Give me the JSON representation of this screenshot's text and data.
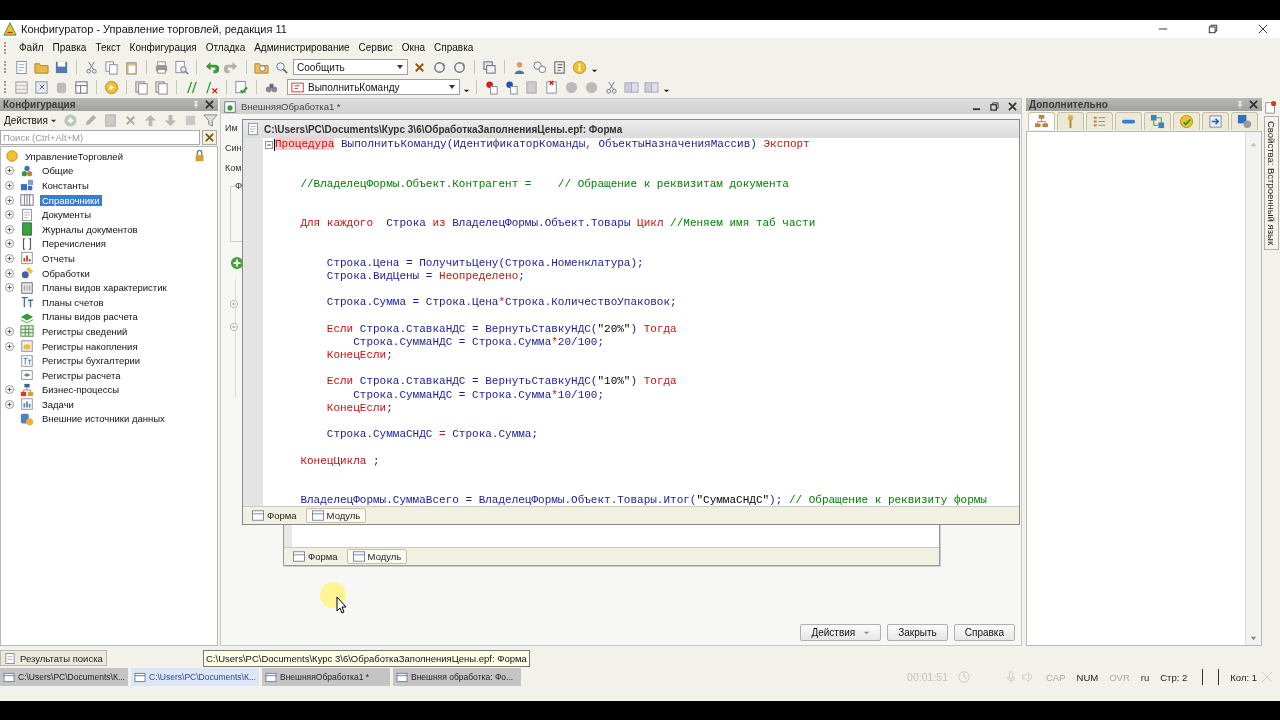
{
  "window": {
    "title": "Конфигуратор - Управление торговлей, редакция 11"
  },
  "menu": [
    "Файл",
    "Правка",
    "Текст",
    "Конфигурация",
    "Отладка",
    "Администрирование",
    "Сервис",
    "Окна",
    "Справка"
  ],
  "toolbar": {
    "search_combo": {
      "value": "Сообщить"
    },
    "procedure_combo": {
      "value": "ВыполнитьКоманду"
    }
  },
  "config_panel": {
    "title": "Конфигурация",
    "actions_label": "Действия",
    "search": {
      "placeholder": "Поиск (Ctrl+Alt+M)"
    },
    "tree": [
      {
        "label": "УправлениеТорговлей",
        "children": [
          {
            "label": "Общие",
            "expandable": true,
            "selected": false
          },
          {
            "label": "Константы",
            "expandable": true,
            "selected": false
          },
          {
            "label": "Справочники",
            "expandable": true,
            "selected": true
          },
          {
            "label": "Документы",
            "expandable": true,
            "selected": false
          },
          {
            "label": "Журналы документов",
            "expandable": true,
            "selected": false
          },
          {
            "label": "Перечисления",
            "expandable": true,
            "selected": false
          },
          {
            "label": "Отчеты",
            "expandable": true,
            "selected": false
          },
          {
            "label": "Обработки",
            "expandable": true,
            "selected": false
          },
          {
            "label": "Планы видов характеристик",
            "expandable": true,
            "selected": false
          },
          {
            "label": "Планы счетов",
            "expandable": false,
            "selected": false
          },
          {
            "label": "Планы видов расчета",
            "expandable": false,
            "selected": false
          },
          {
            "label": "Регистры сведений",
            "expandable": true,
            "selected": false
          },
          {
            "label": "Регистры накопления",
            "expandable": true,
            "selected": false
          },
          {
            "label": "Регистры бухгалтерии",
            "expandable": false,
            "selected": false
          },
          {
            "label": "Регистры расчета",
            "expandable": false,
            "selected": false
          },
          {
            "label": "Бизнес-процессы",
            "expandable": true,
            "selected": false
          },
          {
            "label": "Задачи",
            "expandable": true,
            "selected": false
          },
          {
            "label": "Внешние источники данных",
            "expandable": false,
            "selected": false
          }
        ]
      }
    ]
  },
  "back_window": {
    "title": "ВнешняяОбработка1 *",
    "field_labels": [
      "Им",
      "Син",
      "Ком"
    ],
    "group_label": "Ф",
    "buttons": [
      {
        "label": "Действия",
        "dropdown": true
      },
      {
        "label": "Закрыть",
        "dropdown": false
      },
      {
        "label": "Справка",
        "dropdown": false
      }
    ]
  },
  "inner_window": {
    "tabs": [
      {
        "label": "Форма",
        "selected": false
      },
      {
        "label": "Модуль",
        "selected": true
      }
    ]
  },
  "code_window": {
    "title": "C:\\Users\\PC\\Documents\\Курс 3\\6\\ОбработкаЗаполненияЦены.epf: Форма",
    "lines": [
      {
        "kind": "fold",
        "tokens": [
          {
            "kind": "keyword",
            "text": "Процедура",
            "highlight": true
          },
          {
            "kind": "code",
            "text": " ВыполнитьКоманду(ИдентификаторКоманды"
          },
          {
            "kind": "keyword",
            "text": ","
          },
          {
            "kind": "code",
            "text": " ОбъектыНазначенияМассив) "
          },
          {
            "kind": "keyword",
            "text": "Экспорт"
          }
        ]
      },
      {
        "kind": "blank"
      },
      {
        "kind": "blank"
      },
      {
        "kind": "code",
        "tokens": [
          {
            "kind": "comment",
            "text": "    //ВладелецФормы.Объект.Контрагент =    // Обращение к реквизитам документа"
          }
        ]
      },
      {
        "kind": "blank"
      },
      {
        "kind": "blank"
      },
      {
        "kind": "code",
        "tokens": [
          {
            "kind": "keyword",
            "text": "    Для каждого"
          },
          {
            "kind": "code",
            "text": "  Строка "
          },
          {
            "kind": "keyword",
            "text": "из"
          },
          {
            "kind": "code",
            "text": " ВладелецФормы.Объект.Товары "
          },
          {
            "kind": "keyword",
            "text": "Цикл"
          },
          {
            "kind": "comment",
            "text": " //Меняем имя таб части"
          }
        ]
      },
      {
        "kind": "blank"
      },
      {
        "kind": "blank"
      },
      {
        "kind": "code",
        "tokens": [
          {
            "kind": "code",
            "text": "        Строка.Цена = ПолучитьЦену(Строка.Номенклатура);"
          }
        ]
      },
      {
        "kind": "code",
        "tokens": [
          {
            "kind": "code",
            "text": "        Строка.ВидЦены = "
          },
          {
            "kind": "keyword",
            "text": "Неопределено"
          },
          {
            "kind": "code",
            "text": ";"
          }
        ]
      },
      {
        "kind": "blank"
      },
      {
        "kind": "code",
        "tokens": [
          {
            "kind": "code",
            "text": "        Строка.Сумма = Строка.Цена"
          },
          {
            "kind": "keyword",
            "text": "*"
          },
          {
            "kind": "code",
            "text": "Строка.КоличествоУпаковок;"
          }
        ]
      },
      {
        "kind": "blank"
      },
      {
        "kind": "code",
        "tokens": [
          {
            "kind": "keyword",
            "text": "        Если"
          },
          {
            "kind": "code",
            "text": " Строка.СтавкаНДС = ВернутьСтавкуНДС("
          },
          {
            "kind": "string",
            "text": "\"20%\""
          },
          {
            "kind": "code",
            "text": ") "
          },
          {
            "kind": "keyword",
            "text": "Тогда"
          }
        ]
      },
      {
        "kind": "code",
        "tokens": [
          {
            "kind": "code",
            "text": "            Строка.СуммаНДС = Строка.Сумма"
          },
          {
            "kind": "keyword",
            "text": "*"
          },
          {
            "kind": "code",
            "text": "20/100;"
          }
        ]
      },
      {
        "kind": "code",
        "tokens": [
          {
            "kind": "keyword",
            "text": "        КонецЕсли"
          },
          {
            "kind": "code",
            "text": ";"
          }
        ]
      },
      {
        "kind": "blank"
      },
      {
        "kind": "code",
        "tokens": [
          {
            "kind": "keyword",
            "text": "        Если"
          },
          {
            "kind": "code",
            "text": " Строка.СтавкаНДС = ВернутьСтавкуНДС("
          },
          {
            "kind": "string",
            "text": "\"10%\""
          },
          {
            "kind": "code",
            "text": ") "
          },
          {
            "kind": "keyword",
            "text": "Тогда"
          }
        ]
      },
      {
        "kind": "code",
        "tokens": [
          {
            "kind": "code",
            "text": "            Строка.СуммаНДС = Строка.Сумма"
          },
          {
            "kind": "keyword",
            "text": "*"
          },
          {
            "kind": "code",
            "text": "10/100;"
          }
        ]
      },
      {
        "kind": "code",
        "tokens": [
          {
            "kind": "keyword",
            "text": "        КонецЕсли"
          },
          {
            "kind": "code",
            "text": ";"
          }
        ]
      },
      {
        "kind": "blank"
      },
      {
        "kind": "code",
        "tokens": [
          {
            "kind": "code",
            "text": "        Строка.СуммаСНДС "
          },
          {
            "kind": "keyword",
            "text": "="
          },
          {
            "kind": "code",
            "text": " Строка.Сумма;"
          }
        ]
      },
      {
        "kind": "blank"
      },
      {
        "kind": "code",
        "tokens": [
          {
            "kind": "keyword",
            "text": "    КонецЦикла "
          },
          {
            "kind": "code",
            "text": ";"
          }
        ]
      },
      {
        "kind": "blank"
      },
      {
        "kind": "blank"
      },
      {
        "kind": "code",
        "tokens": [
          {
            "kind": "code",
            "text": "    ВладелецФормы.СуммаВсего = ВладелецФормы.Объект.Товары.Итог("
          },
          {
            "kind": "string",
            "text": "\"СуммаСНДС\""
          },
          {
            "kind": "code",
            "text": "); "
          },
          {
            "kind": "comment",
            "text": "// Обращение к реквизиту формы"
          }
        ]
      }
    ],
    "tabs": [
      {
        "label": "Форма",
        "selected": false
      },
      {
        "label": "Модуль",
        "selected": true
      }
    ]
  },
  "extra_panel": {
    "title": "Дополнительно",
    "tabs": [
      {
        "selected": true
      },
      {
        "selected": false
      },
      {
        "selected": false
      },
      {
        "selected": false
      },
      {
        "selected": false
      },
      {
        "selected": false
      },
      {
        "selected": false
      },
      {
        "selected": false
      }
    ]
  },
  "side_tab": {
    "label": "Свойства: Встроенный язык"
  },
  "panel_tabs": [
    {
      "label": "Результаты поиска"
    }
  ],
  "tooltip": "C:\\Users\\PC\\Documents\\Курс 3\\6\\ОбработкаЗаполненияЦены.epf: Форма",
  "window_tabs": [
    {
      "label": "C:\\Users\\PC\\Documents\\К...",
      "selected": false
    },
    {
      "label": "C:\\Users\\PC\\Documents\\К...",
      "selected": true
    },
    {
      "label": "ВнешняяОбработка1 *",
      "selected": false
    },
    {
      "label": "Внешняя обработка: Фо...",
      "selected": false
    }
  ],
  "status_bar": {
    "timer": "00:01:51",
    "indicators": [
      {
        "label": "CAP",
        "on": false
      },
      {
        "label": "NUM",
        "on": true
      },
      {
        "label": "OVR",
        "on": false
      }
    ],
    "language": "ru",
    "line": "Стр: 2",
    "column": "Кол: 1"
  }
}
